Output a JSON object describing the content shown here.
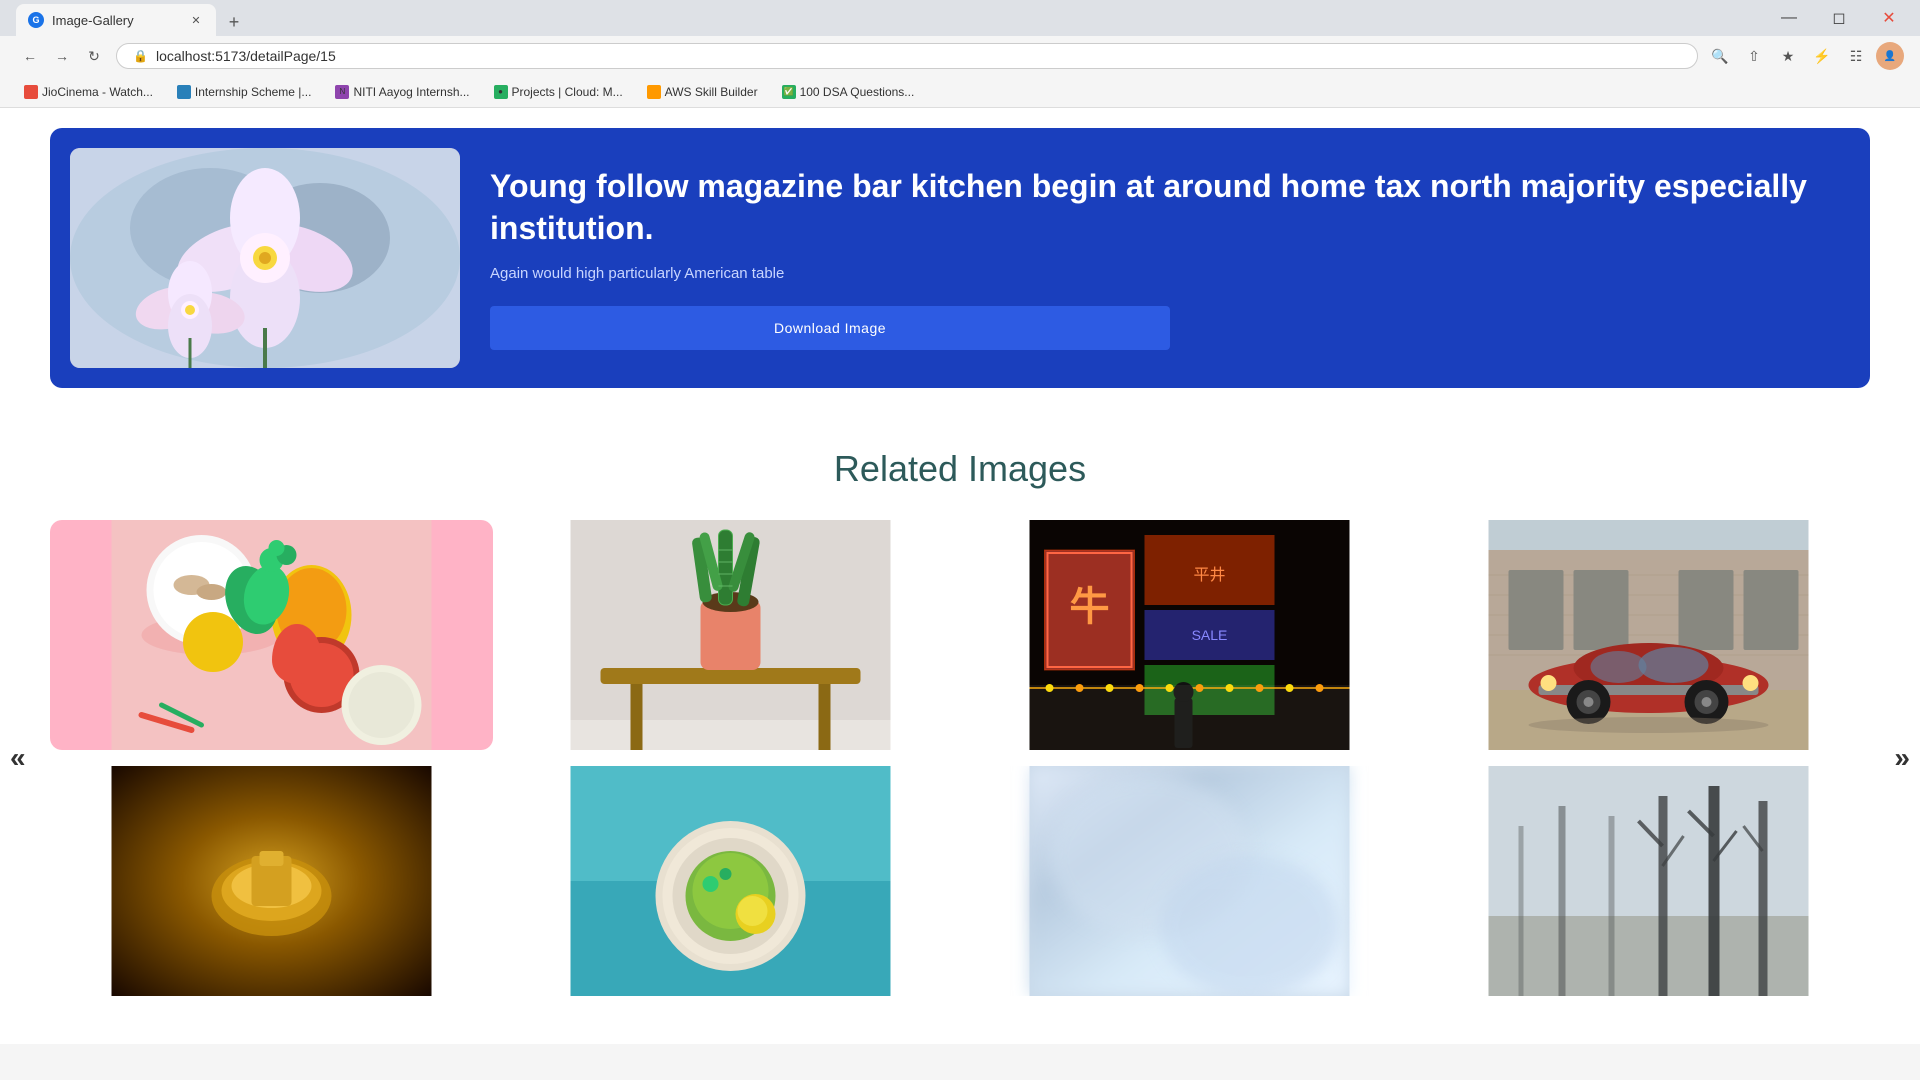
{
  "browser": {
    "tab_title": "Image-Gallery",
    "url": "localhost:5173/detailPage/15",
    "bookmarks": [
      {
        "label": "JioCinema - Watch...",
        "favicon_color": "#e74c3c"
      },
      {
        "label": "Internship Scheme |...",
        "favicon_color": "#2980b9"
      },
      {
        "label": "NITI Aayog Internsh...",
        "favicon_color": "#8e44ad"
      },
      {
        "label": "Projects | Cloud: M...",
        "favicon_color": "#27ae60"
      },
      {
        "label": "AWS Skill Builder",
        "favicon_color": "#ff9900"
      },
      {
        "label": "100 DSA Questions...",
        "favicon_color": "#27ae60"
      }
    ]
  },
  "hero": {
    "title": "Young follow magazine bar kitchen begin at around home tax north majority especially institution.",
    "subtitle": "Again would high particularly American table",
    "download_button": "Download Image"
  },
  "related": {
    "section_title": "Related Images",
    "prev_arrow": "«",
    "next_arrow": "»",
    "images": [
      {
        "id": 1,
        "type": "vegetables",
        "alt": "Vegetables on pink background"
      },
      {
        "id": 2,
        "type": "plant",
        "alt": "Snake plant in pink pot on wooden stool"
      },
      {
        "id": 3,
        "type": "nightmarket",
        "alt": "Night market with neon signs"
      },
      {
        "id": 4,
        "type": "car",
        "alt": "Red vintage car near brick building"
      },
      {
        "id": 5,
        "type": "gold",
        "alt": "Golden decorative item"
      },
      {
        "id": 6,
        "type": "food2",
        "alt": "Food plate on teal background"
      },
      {
        "id": 7,
        "type": "abstract",
        "alt": "Abstract blurry image"
      },
      {
        "id": 8,
        "type": "trees",
        "alt": "Trees in winter fog"
      }
    ]
  }
}
